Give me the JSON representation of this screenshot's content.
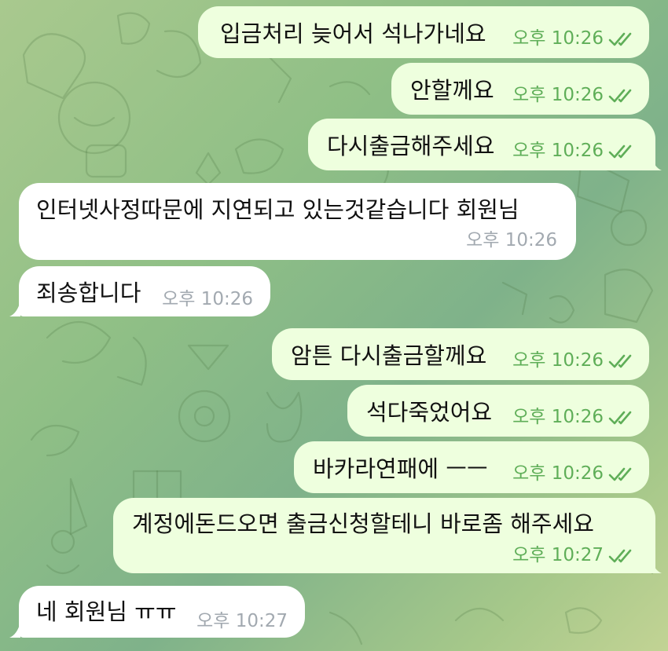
{
  "messages": [
    {
      "dir": "out",
      "text": "입금처리 늦어서 석나가네요",
      "time": "오후 10:26",
      "read": true
    },
    {
      "dir": "out",
      "text": "안할께요",
      "time": "오후 10:26",
      "read": true
    },
    {
      "dir": "out",
      "text": "다시출금해주세요",
      "time": "오후 10:26",
      "read": true
    },
    {
      "dir": "in",
      "text": "인터넷사정따문에 지연되고 있는것같습니다 회원님",
      "time": "오후 10:26"
    },
    {
      "dir": "in",
      "text": "죄송합니다",
      "time": "오후 10:26"
    },
    {
      "dir": "out",
      "text": "암튼 다시출금할께요",
      "time": "오후 10:26",
      "read": true
    },
    {
      "dir": "out",
      "text": "석다죽었어요",
      "time": "오후 10:26",
      "read": true
    },
    {
      "dir": "out",
      "text": "바카라연패에 ㅡㅡ",
      "time": "오후 10:26",
      "read": true
    },
    {
      "dir": "out",
      "text": "계정에돈드오면 출금신청할테니 바로좀 해주세요",
      "time": "오후 10:27",
      "read": true
    },
    {
      "dir": "in",
      "text": "네 회원님 ㅠㅠ",
      "time": "오후 10:27"
    }
  ],
  "icons": {
    "read_receipt": "double-check-icon"
  },
  "colors": {
    "outgoing_bubble": "#eeffde",
    "incoming_bubble": "#ffffff",
    "outgoing_meta": "#5fae58",
    "incoming_meta": "#a2a9b0"
  }
}
